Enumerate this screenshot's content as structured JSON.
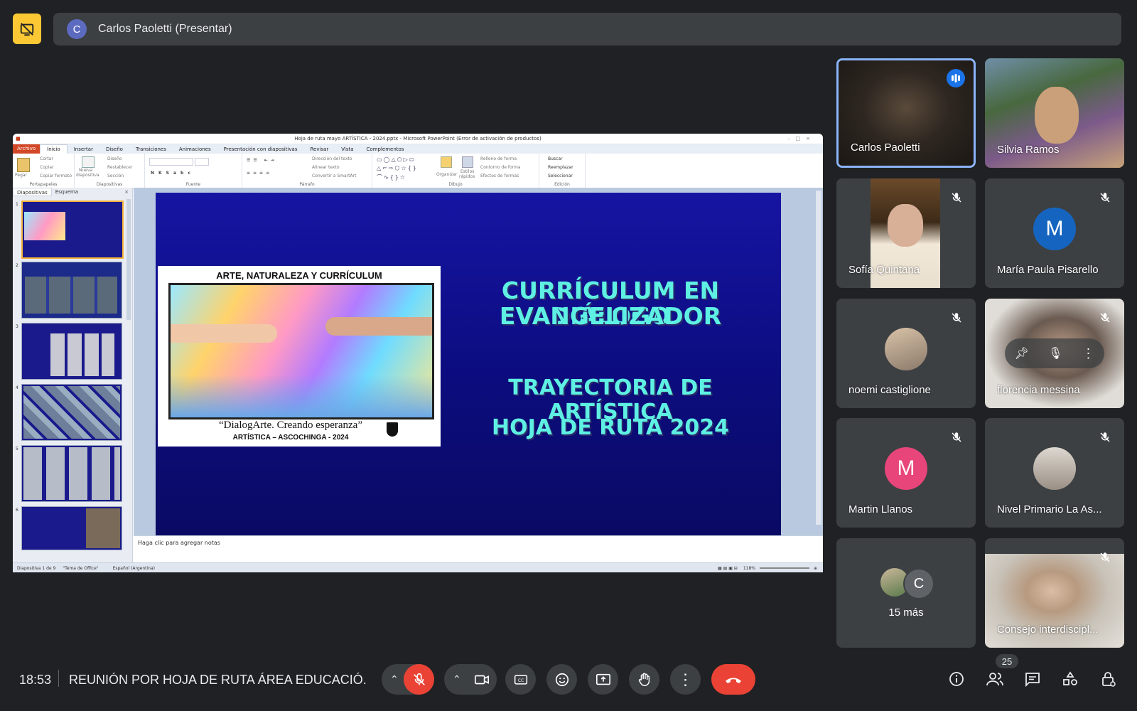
{
  "top_bar": {
    "presenter_initial": "C",
    "presenter_label": "Carlos Paoletti (Presentar)"
  },
  "ppt": {
    "title": "Hoja de ruta mayo ARTÍSTICA - 2024.pptx  -  Microsoft PowerPoint (Error de activación de productos)",
    "tabs": [
      "Archivo",
      "Inicio",
      "Insertar",
      "Diseño",
      "Transiciones",
      "Animaciones",
      "Presentación con diapositivas",
      "Revisar",
      "Vista",
      "Complementos"
    ],
    "ribbon": {
      "pegar": "Pegar",
      "cortar": "Cortar",
      "copiar": "Copiar",
      "copiar_formato": "Copiar formato",
      "portapapeles": "Portapapeles",
      "nueva": "Nueva",
      "diapositiva": "diapositiva",
      "diseno": "Diseño",
      "restablecer": "Restablecer",
      "seccion": "Sección",
      "diapositivas": "Diapositivas",
      "fuente": "Fuente",
      "direccion_texto": "Dirección del texto",
      "alinear_texto": "Alinear texto",
      "convertir_smartart": "Convertir a SmartArt",
      "parrafo": "Párrafo",
      "organizar": "Organizar",
      "estilos": "Estilos",
      "rapidos": "rápidos",
      "relleno_forma": "Relleno de forma",
      "contorno_forma": "Contorno de forma",
      "efectos_formas": "Efectos de formas",
      "dibujo": "Dibujo",
      "buscar": "Buscar",
      "reemplazar": "Reemplazar",
      "seleccionar": "Seleccionar",
      "edicion": "Edición"
    },
    "left_tabs": [
      "Diapositivas",
      "Esquema"
    ],
    "thumbs": [
      "1",
      "2",
      "3",
      "4",
      "5",
      "6"
    ],
    "notes_placeholder": "Haga clic para agregar notas",
    "status": {
      "slide": "Diapositiva 1 de 9",
      "theme": "\"Tema de Office\"",
      "language": "Español (Argentina)",
      "zoom": "118%"
    },
    "slide": {
      "image_caption_top": "ARTE, NATURALEZA Y CURRÍCULUM",
      "image_caption_quote": "“DialogArte. Creando esperanza”",
      "image_caption_bottom": "ARTÍSTICA – ASCOCHINGA - 2024",
      "heading_line1": "CURRÍCULUM EN DIÁLOGO",
      "heading_line2": "EVANGELIZADOR",
      "heading2_line1": "TRAYECTORIA DE ARTÍSTICA",
      "heading2_line2": "HOJA DE RUTA 2024"
    }
  },
  "participants": [
    {
      "name": "Carlos Paoletti",
      "speaking": true
    },
    {
      "name": "Silvia Ramos"
    },
    {
      "name": "Sofía Quintana",
      "muted": true
    },
    {
      "name": "María Paula Pisarello",
      "initial": "M",
      "color": "#1565c0",
      "muted": true
    },
    {
      "name": "noemi castiglione",
      "muted": true
    },
    {
      "name": "florencia messina",
      "muted": true
    },
    {
      "name": "Martin Llanos",
      "initial": "M",
      "color": "#e8457a",
      "muted": true
    },
    {
      "name": "Nivel Primario La As...",
      "muted": true
    },
    {
      "more": "15 más",
      "initial": "C"
    },
    {
      "name": "Consejo interdiscipl...",
      "muted": true
    }
  ],
  "bottom_bar": {
    "time": "18:53",
    "meeting_title": "REUNIÓN POR HOJA DE RUTA ÁREA EDUCACIÓ...",
    "participant_count": "25"
  },
  "colors": {
    "background": "#202124",
    "tile": "#3c4043",
    "accent_yellow": "#fcc934",
    "mic_off_red": "#ea4335",
    "speaking_blue": "#8ab4f8"
  }
}
